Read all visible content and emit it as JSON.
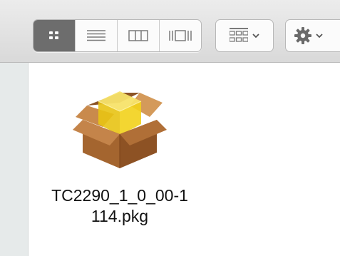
{
  "toolbar": {
    "view_buttons": [
      {
        "name": "icon-view",
        "active": true
      },
      {
        "name": "list-view",
        "active": false
      },
      {
        "name": "column-view",
        "active": false
      },
      {
        "name": "cover-flow-view",
        "active": false
      }
    ],
    "arrange_icon": "group-arrange-icon",
    "action_icon": "gear-icon",
    "dropdown_icon": "chevron-down-icon"
  },
  "files": [
    {
      "name_line1": "TC2290_1_0_00-1",
      "name_line2": "114.pkg",
      "icon": "package-box-icon"
    }
  ],
  "colors": {
    "active_segment": "#6d6d6d",
    "box_brown": "#a4652f",
    "package_yellow": "#f2d21b"
  }
}
